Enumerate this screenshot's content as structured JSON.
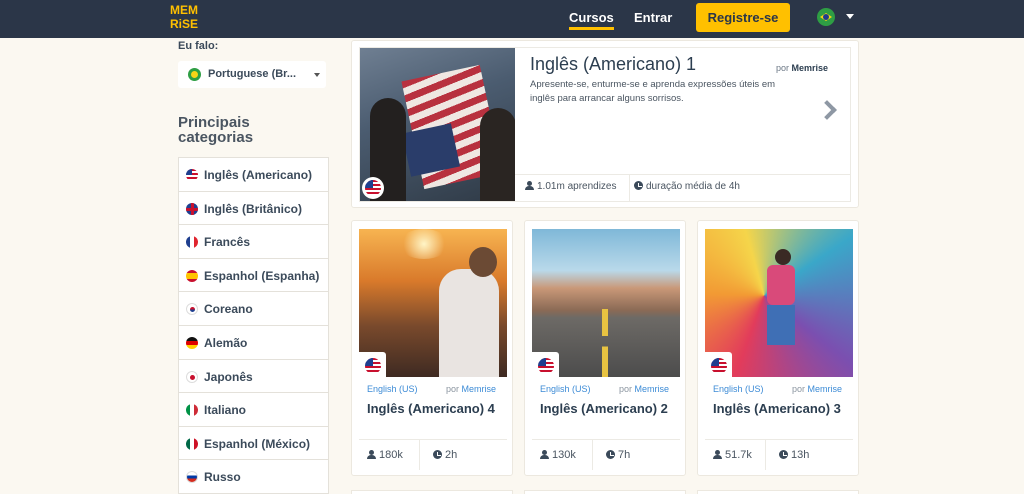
{
  "header": {
    "logo_text": "MEM RiSE",
    "nav": [
      {
        "label": "Cursos",
        "active": true
      },
      {
        "label": "Entrar",
        "active": false
      }
    ],
    "signup_label": "Registre-se",
    "language_icon": "brazil-flag-icon"
  },
  "sidebar": {
    "speak_label": "Eu falo:",
    "speak_value": "Portuguese (Br...",
    "categories_title": "Principais categorias",
    "categories": [
      {
        "label": "Inglês (Americano)",
        "icon": "us-flag-icon"
      },
      {
        "label": "Inglês (Britânico)",
        "icon": "uk-flag-icon"
      },
      {
        "label": "Francês",
        "icon": "france-flag-icon"
      },
      {
        "label": "Espanhol (Espanha)",
        "icon": "spain-flag-icon"
      },
      {
        "label": "Coreano",
        "icon": "korea-flag-icon"
      },
      {
        "label": "Alemão",
        "icon": "germany-flag-icon"
      },
      {
        "label": "Japonês",
        "icon": "japan-flag-icon"
      },
      {
        "label": "Italiano",
        "icon": "italy-flag-icon"
      },
      {
        "label": "Espanhol (México)",
        "icon": "mexico-flag-icon"
      },
      {
        "label": "Russo",
        "icon": "russia-flag-icon"
      }
    ]
  },
  "featured": {
    "title": "Inglês (Americano) 1",
    "by_prefix": "por",
    "by_author": "Memrise",
    "description": "Apresente-se, enturme-se e aprenda expressões úteis em inglês para arrancar alguns sorrisos.",
    "learners": "1.01m aprendizes",
    "duration": "duração média de 4h"
  },
  "courses": [
    {
      "lang": "English (US)",
      "by_prefix": "por",
      "by_author": "Memrise",
      "title": "Inglês (Americano) 4",
      "learners": "180k",
      "duration": "2h"
    },
    {
      "lang": "English (US)",
      "by_prefix": "por",
      "by_author": "Memrise",
      "title": "Inglês (Americano) 2",
      "learners": "130k",
      "duration": "7h"
    },
    {
      "lang": "English (US)",
      "by_prefix": "por",
      "by_author": "Memrise",
      "title": "Inglês (Americano) 3",
      "learners": "51.7k",
      "duration": "13h"
    }
  ],
  "colors": {
    "header_bg": "#2b3648",
    "accent": "#ffc000",
    "page_bg": "#fbf8f1",
    "link": "#3c8bd6"
  }
}
